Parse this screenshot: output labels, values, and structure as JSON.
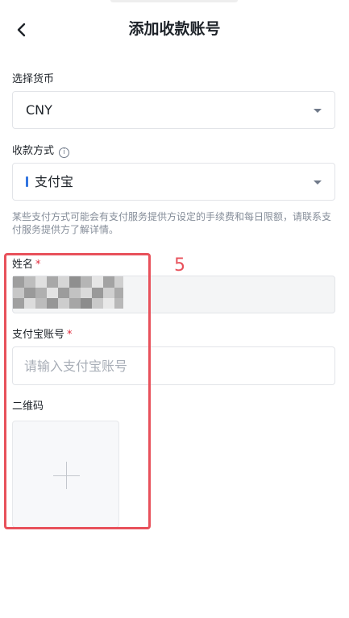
{
  "header": {
    "title": "添加收款账号",
    "back_icon": "chevron-left-icon"
  },
  "currency": {
    "label": "选择货币",
    "value": "CNY"
  },
  "method": {
    "label": "收款方式",
    "value": "支付宝",
    "accent": "#3375e0"
  },
  "notice": "某些支付方式可能会有支付服务提供方设定的手续费和每日限额，请联系支付服务提供方了解详情。",
  "name": {
    "label": "姓名",
    "required_mark": "*"
  },
  "account": {
    "label": "支付宝账号",
    "required_mark": "*",
    "placeholder": "请输入支付宝账号"
  },
  "qrcode": {
    "label": "二维码"
  },
  "annotation": {
    "label": "5",
    "color": "#e8515b"
  }
}
